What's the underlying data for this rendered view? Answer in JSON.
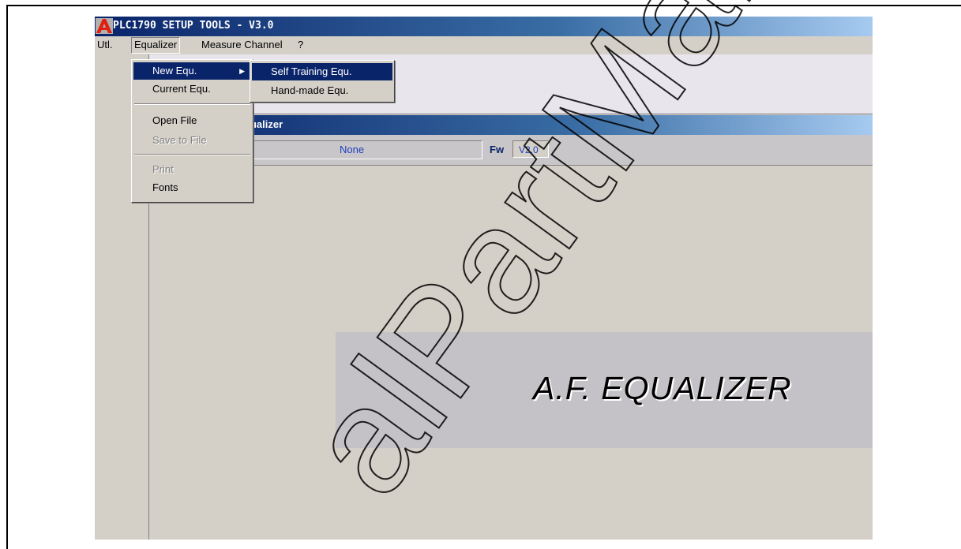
{
  "window": {
    "title": "PLC1790 SETUP TOOLS  -  V3.0",
    "logo_icon": "app-logo-icon"
  },
  "menubar": {
    "items": [
      {
        "label": "Utl."
      },
      {
        "label": "Equalizer"
      },
      {
        "label": "Measure Channel"
      },
      {
        "label": "?"
      }
    ]
  },
  "equalizer_menu": {
    "items": [
      {
        "label": "New Equ.",
        "state": "highlighted",
        "has_submenu": true
      },
      {
        "label": "Current Equ.",
        "state": "normal"
      },
      {
        "label": "Open File",
        "state": "normal"
      },
      {
        "label": "Save to File",
        "state": "disabled"
      },
      {
        "label": "Print",
        "state": "disabled"
      },
      {
        "label": "Fonts",
        "state": "normal"
      }
    ]
  },
  "new_equ_submenu": {
    "items": [
      {
        "label": "Self Training Equ.",
        "state": "highlighted"
      },
      {
        "label": "Hand-made Equ.",
        "state": "normal"
      }
    ]
  },
  "panel": {
    "title_fragment": "qualizer",
    "status_value": "None",
    "fw_label": "Fw",
    "fw_value": "V2.0"
  },
  "banner": {
    "text": "A.F. EQUALIZER"
  },
  "watermark": {
    "text": "alPartManual"
  },
  "colors": {
    "title_gradient_start": "#0a246a",
    "title_gradient_end": "#a6caf0",
    "highlight": "#0a246a",
    "window_bg": "#d4d0c8",
    "field_text": "#2040c0"
  }
}
